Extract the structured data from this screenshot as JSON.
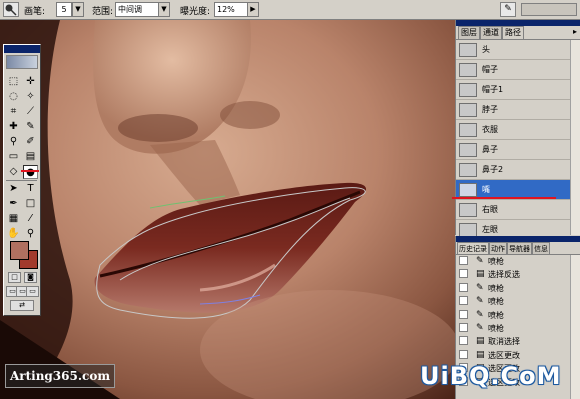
{
  "options_bar": {
    "tool_icon": "dodge-tool-icon",
    "brush_label": "画笔:",
    "brush_size": "5",
    "range_label": "范围:",
    "range_value": "中间调",
    "exposure_label": "曝光度:",
    "exposure_value": "12%",
    "airbrush_icon": "airbrush-icon"
  },
  "layers_panel": {
    "tabs": [
      "图层",
      "通道",
      "路径"
    ],
    "active_tab": "路径",
    "rows": [
      {
        "name": "头"
      },
      {
        "name": "帽子"
      },
      {
        "name": "帽子1"
      },
      {
        "name": "脖子"
      },
      {
        "name": "衣服"
      },
      {
        "name": "鼻子"
      },
      {
        "name": "鼻子2"
      },
      {
        "name": "嘴"
      },
      {
        "name": "右眼"
      },
      {
        "name": "左眼"
      }
    ],
    "selected": "嘴"
  },
  "history_panel": {
    "tabs": [
      "历史记录",
      "动作",
      "导航器",
      "信息"
    ],
    "items": [
      {
        "name": "喷枪",
        "icon": "airbrush-icon"
      },
      {
        "name": "选择反选",
        "icon": "history-state-icon"
      },
      {
        "name": "喷枪",
        "icon": "airbrush-icon"
      },
      {
        "name": "喷枪",
        "icon": "airbrush-icon"
      },
      {
        "name": "喷枪",
        "icon": "airbrush-icon"
      },
      {
        "name": "喷枪",
        "icon": "airbrush-icon"
      },
      {
        "name": "取消选择",
        "icon": "history-state-icon"
      },
      {
        "name": "选区更改",
        "icon": "history-state-icon"
      },
      {
        "name": "选区更改",
        "icon": "history-state-icon"
      },
      {
        "name": "选区更改",
        "icon": "history-state-icon"
      }
    ]
  },
  "toolbox": {
    "foreground_color": "#b07060",
    "background_color": "#a23a2c"
  },
  "watermarks": {
    "left": "Arting365.com",
    "right": "UiBQ.CoM"
  },
  "colors": {
    "selection_blue": "#316ac5",
    "annotation_red": "#e0141e",
    "panel_gray": "#d4d0c8"
  }
}
